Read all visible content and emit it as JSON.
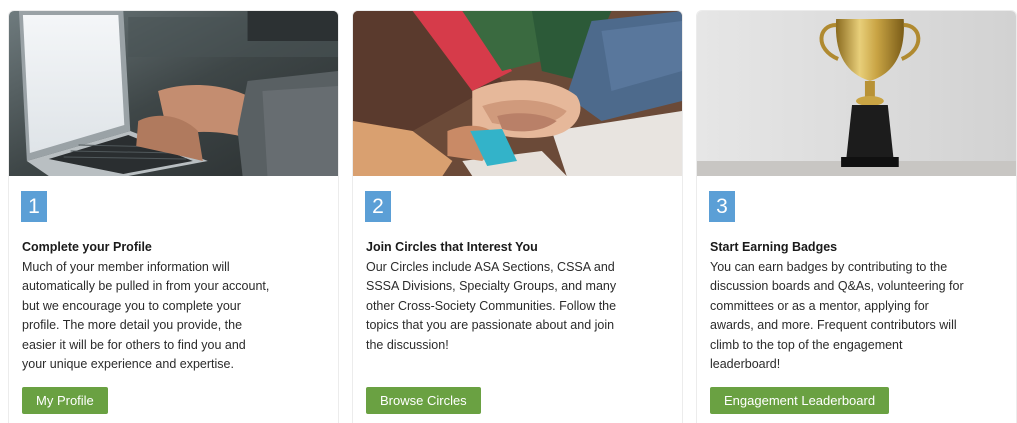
{
  "cards": [
    {
      "number": "1",
      "title": "Complete your Profile",
      "lines": [
        "Much of your member information will",
        "automatically be pulled in from your account,",
        "but we encourage you to complete your",
        "profile. The more detail you provide, the",
        "easier it will be for others to find you and",
        "your unique experience and expertise."
      ],
      "button": "My Profile",
      "image_icon": "laptop-typing-photo"
    },
    {
      "number": "2",
      "title": "Join Circles that Interest You",
      "lines": [
        "Our Circles include ASA Sections, CSSA and",
        "SSSA Divisions, Specialty Groups, and many",
        "other Cross-Society Communities. Follow the",
        "topics that you are passionate about and join",
        "the discussion!"
      ],
      "button": "Browse Circles",
      "image_icon": "stacked-hands-photo"
    },
    {
      "number": "3",
      "title": "Start Earning Badges",
      "lines": [
        "You can earn badges by contributing to the",
        "discussion boards and Q&As, volunteering for",
        "committees or as a mentor, applying for",
        "awards, and more. Frequent contributors will",
        "climb to the top of the engagement",
        "leaderboard!"
      ],
      "button": "Engagement Leaderboard",
      "image_icon": "trophy-photo"
    }
  ],
  "colors": {
    "number_badge": "#5b9fd6",
    "button": "#6aa142"
  }
}
